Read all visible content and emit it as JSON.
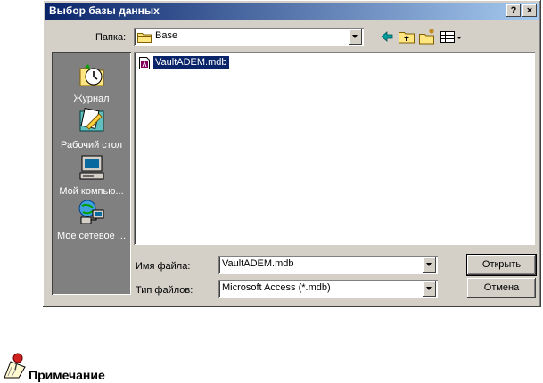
{
  "dialog": {
    "title": "Выбор базы данных",
    "help_label": "?",
    "close_label": "×"
  },
  "toolbar": {
    "folder_label": "Папка:",
    "folder_value": "Base",
    "icons": [
      "back-arrow-icon",
      "up-folder-icon",
      "new-folder-icon",
      "view-menu-icon"
    ]
  },
  "places": [
    {
      "label": "Журнал",
      "icon": "history-icon"
    },
    {
      "label": "Рабочий стол",
      "icon": "desktop-icon"
    },
    {
      "label": "Мой компью...",
      "icon": "my-computer-icon"
    },
    {
      "label": "Мое сетевое ...",
      "icon": "network-places-icon"
    }
  ],
  "files": [
    {
      "name": "VaultADEM.mdb",
      "icon": "access-db-icon",
      "selected": true
    }
  ],
  "fields": {
    "filename_label": "Имя файла:",
    "filename_value": "VaultADEM.mdb",
    "filetype_label": "Тип файлов:",
    "filetype_value": "Microsoft Access (*.mdb)"
  },
  "buttons": {
    "open_label": "Открыть",
    "cancel_label": "Отмена"
  },
  "note": {
    "label": "Примечание",
    "icon": "note-pin-icon"
  },
  "colors": {
    "dialog_bg": "#d4d0c8",
    "title_start": "#0a246a",
    "title_end": "#a6caf0",
    "places_bg": "#808080",
    "selection": "#0a246a"
  }
}
